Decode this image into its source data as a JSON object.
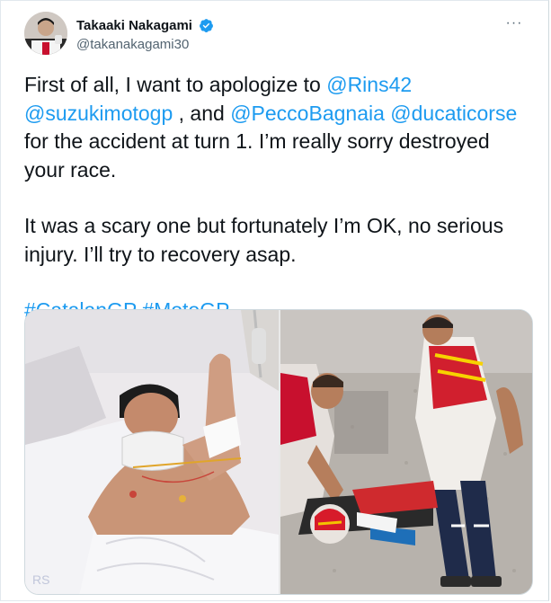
{
  "user": {
    "display_name": "Takaaki Nakagami",
    "handle": "@takanakagami30",
    "verified": true
  },
  "menu": {
    "more_label": "···"
  },
  "tweet": {
    "line1_pre": "First of all, I want to apologize to ",
    "mention_rins": "@Rins42",
    "mention_suzuki": "@suzukimotogp",
    "line2_mid": " , and ",
    "mention_pecco": "@PeccoBagnaia",
    "mention_ducati": "@ducaticorse",
    "line3": "for the accident at turn 1. I’m really sorry destroyed your race.",
    "para2": "It was a scary one but fortunately I’m OK, no serious injury. I’ll try to recovery asap.",
    "hashtag_catalan": "#CatalanGP",
    "hashtag_motogp": "#MotoGP"
  },
  "media": {
    "photos": [
      {
        "subject": "rider in hospital bed with neck brace giving thumbs up"
      },
      {
        "subject": "marshals attending crashed rider on track"
      }
    ]
  },
  "colors": {
    "link": "#1d9bf0",
    "text": "#0f1419",
    "secondary": "#536471",
    "verified": "#1d9bf0"
  }
}
